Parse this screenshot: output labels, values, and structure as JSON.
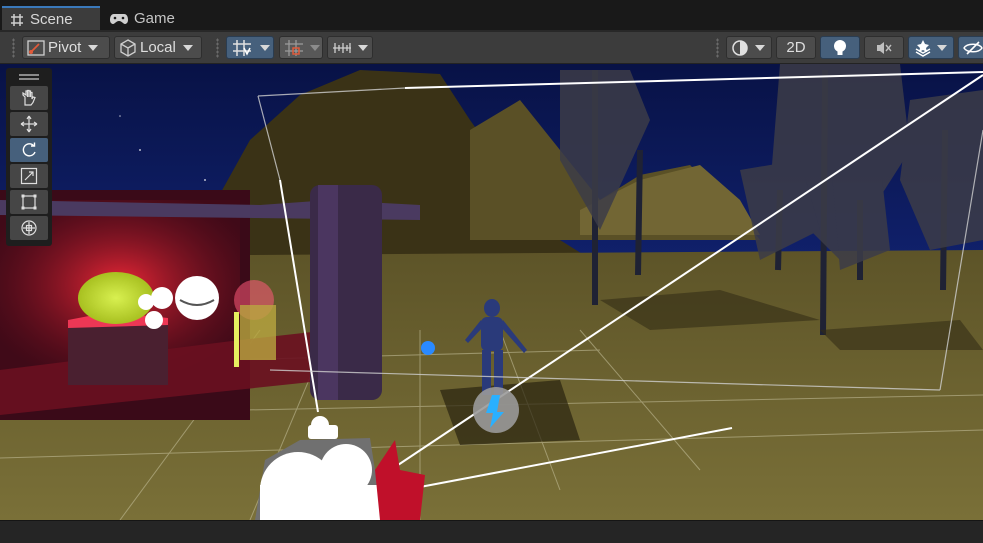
{
  "tabs": [
    {
      "label": "Scene",
      "icon": "grid-hash-icon",
      "active": true
    },
    {
      "label": "Game",
      "icon": "gamepad-icon",
      "active": false
    }
  ],
  "toolbar": {
    "pivot_label": "Pivot",
    "local_label": "Local",
    "mode_2d_label": "2D"
  },
  "tools": [
    {
      "name": "hand-tool",
      "icon": "hand-icon",
      "active": false
    },
    {
      "name": "move-tool",
      "icon": "move-arrows-icon",
      "active": false
    },
    {
      "name": "rotate-tool",
      "icon": "rotate-icon",
      "active": true
    },
    {
      "name": "scale-tool",
      "icon": "scale-icon",
      "active": false
    },
    {
      "name": "rect-tool",
      "icon": "rect-transform-icon",
      "active": false
    },
    {
      "name": "transform-tool",
      "icon": "transform-icon",
      "active": false
    }
  ],
  "colors": {
    "accent": "#3a79bb",
    "toolbar_bg": "#3c3c3c",
    "active_button": "#46607c",
    "sky": "#0c1a55",
    "ground": "#6b6232"
  }
}
